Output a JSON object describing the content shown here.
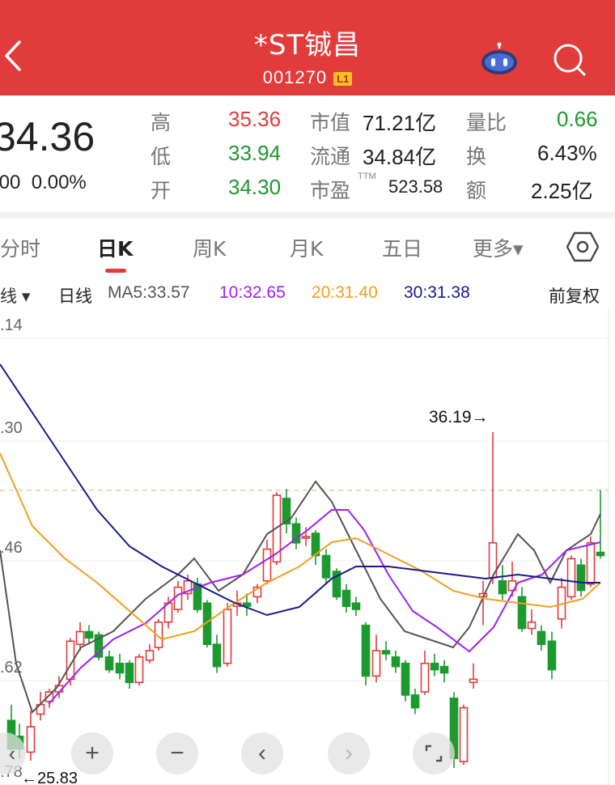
{
  "header": {
    "title": "*ST铖昌",
    "code": "001270",
    "level": "L1"
  },
  "quote": {
    "price": "34.36",
    "change": ".00",
    "change_pct": "0.00%",
    "high_label": "高",
    "high": "35.36",
    "low_label": "低",
    "low": "33.94",
    "open_label": "开",
    "open": "34.30",
    "mktcap_label": "市值",
    "mktcap": "71.21亿",
    "float_label": "流通",
    "float": "34.84亿",
    "pe_label": "市盈",
    "pe_tag": "TTM",
    "pe": "523.58",
    "vr_label": "量比",
    "vr": "0.66",
    "turn_label": "换",
    "turn": "6.43%",
    "amt_label": "额",
    "amt": "2.25亿",
    "colors": {
      "up": "#e23b3b",
      "down": "#1d9a2f"
    }
  },
  "tabs": [
    "分时",
    "日K",
    "周K",
    "月K",
    "五日",
    "更多▾"
  ],
  "active_tab": "日K",
  "indicator": {
    "type": "线 ▾",
    "period": "日线",
    "ma5": "MA5:33.57",
    "ma10": "10:32.65",
    "ma20": "20:31.40",
    "ma30": "30:31.38",
    "adjust": "前复权",
    "colors": {
      "ma5": "#555555",
      "ma10": "#a020f0",
      "ma20": "#f0a020",
      "ma30": "#1a1a8c"
    }
  },
  "chart_data": {
    "type": "candlestick",
    "y_ticks": [
      ".14",
      ".30",
      ".46",
      ".62",
      ".78"
    ],
    "annotations": {
      "high": "36.19→",
      "low": "←25.83"
    },
    "high": 36.19,
    "low": 25.83,
    "current": 34.36
  },
  "controls": [
    "+",
    "−",
    "‹",
    "›"
  ]
}
